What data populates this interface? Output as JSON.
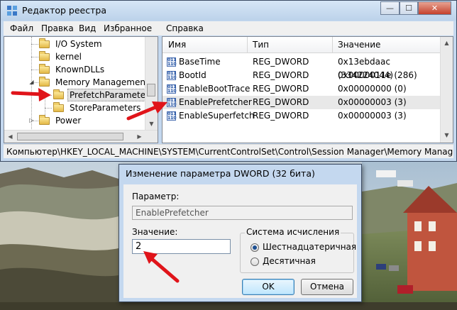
{
  "registry_editor": {
    "title": "Редактор реестра",
    "window_buttons": {
      "minimize": "—",
      "maximize": "☐",
      "close": "✕"
    },
    "menu": [
      "Файл",
      "Правка",
      "Вид",
      "Избранное",
      "Справка"
    ],
    "tree": [
      {
        "label": "I/O System"
      },
      {
        "label": "kernel"
      },
      {
        "label": "KnownDLLs"
      },
      {
        "label": "Memory Management"
      },
      {
        "label": "PrefetchParameters",
        "selected": true
      },
      {
        "label": "StoreParameters"
      },
      {
        "label": "Power"
      }
    ],
    "columns": [
      "Имя",
      "Тип",
      "Значение"
    ],
    "values": [
      {
        "name": "BaseTime",
        "type": "REG_DWORD",
        "data": "0x13ebdaac (334224044)"
      },
      {
        "name": "BootId",
        "type": "REG_DWORD",
        "data": "0x0000011e (286)"
      },
      {
        "name": "EnableBootTrace",
        "type": "REG_DWORD",
        "data": "0x00000000 (0)"
      },
      {
        "name": "EnablePrefetcher",
        "type": "REG_DWORD",
        "data": "0x00000003 (3)",
        "selected": true
      },
      {
        "name": "EnableSuperfetch",
        "type": "REG_DWORD",
        "data": "0x00000003 (3)"
      }
    ],
    "status_path": "Компьютер\\HKEY_LOCAL_MACHINE\\SYSTEM\\CurrentControlSet\\Control\\Session Manager\\Memory Management"
  },
  "dword_dialog": {
    "title": "Изменение параметра DWORD (32 бита)",
    "parameter_label": "Параметр:",
    "parameter_value": "EnablePrefetcher",
    "value_label": "Значение:",
    "value_input": "2",
    "radix_group_label": "Система исчисления",
    "radix_options": [
      {
        "label": "Шестнадцатеричная",
        "checked": true
      },
      {
        "label": "Десятичная",
        "checked": false
      }
    ],
    "ok_label": "OK",
    "cancel_label": "Отмена"
  },
  "colors": {
    "window_frame": "#c4d8ef",
    "annotation_arrow": "#e0141a",
    "selection": "#e8e8e8"
  },
  "icons": [
    "registry-editor-icon",
    "folder-icon",
    "reg-dword-icon",
    "red-arrow-annotation"
  ]
}
